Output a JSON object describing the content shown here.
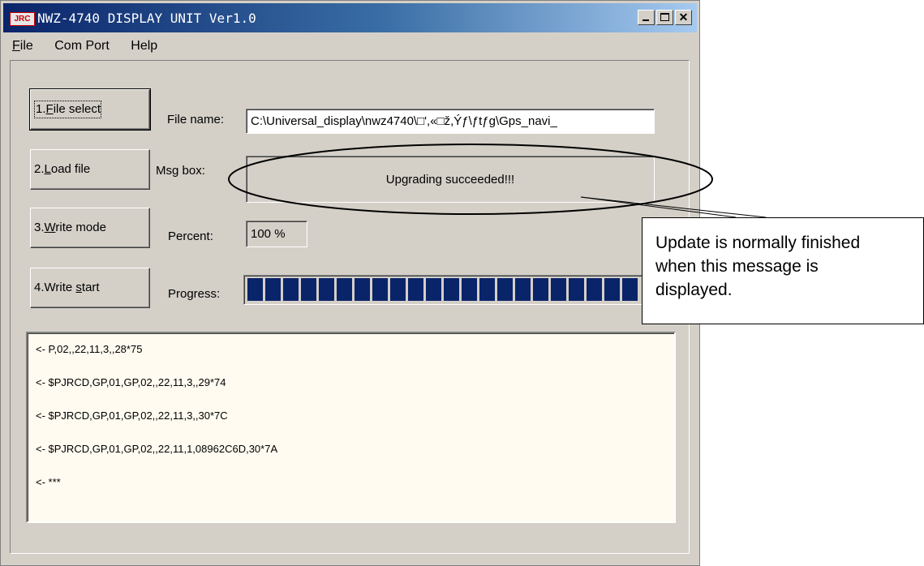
{
  "window": {
    "logo_text": "JRC",
    "title": "NWZ-4740 DISPLAY UNIT Ver1.0"
  },
  "menu": {
    "file": {
      "ul": "F",
      "rest": "ile"
    },
    "com_port": "Com Port",
    "help": "Help"
  },
  "buttons": {
    "file_select": {
      "pre": "1.",
      "ul": "F",
      "post": "ile select"
    },
    "load_file": {
      "pre": "2.",
      "ul": "L",
      "post": "oad file"
    },
    "write_mode": {
      "pre": "3.",
      "ul": "W",
      "post": "rite mode"
    },
    "write_start": {
      "pre": "4.Write ",
      "ul": "s",
      "post": "tart"
    }
  },
  "labels": {
    "file_name": "File name:",
    "msg_box": "Msg box:",
    "percent": "Percent:",
    "progress": "Progress:"
  },
  "fields": {
    "file_name": "C:\\Universal_display\\nwz4740\\□',«□ž,Ýƒ\\ƒtƒg\\Gps_navi_",
    "msg_box": "Upgrading succeeded!!!",
    "percent": "100 %",
    "progress_fraction": 1.0
  },
  "log": {
    "lines": [
      "<- P,02,,22,11,3,,28*75",
      "<- $PJRCD,GP,01,GP,02,,22,11,3,,29*74",
      "<- $PJRCD,GP,01,GP,02,,22,11,3,,30*7C",
      "<- $PJRCD,GP,01,GP,02,,22,11,1,08962C6D,30*7A",
      "<- ***"
    ]
  },
  "annotation": {
    "callout_line1": "Update is normally finished",
    "callout_line2": "when this message is",
    "callout_line3": "displayed."
  }
}
